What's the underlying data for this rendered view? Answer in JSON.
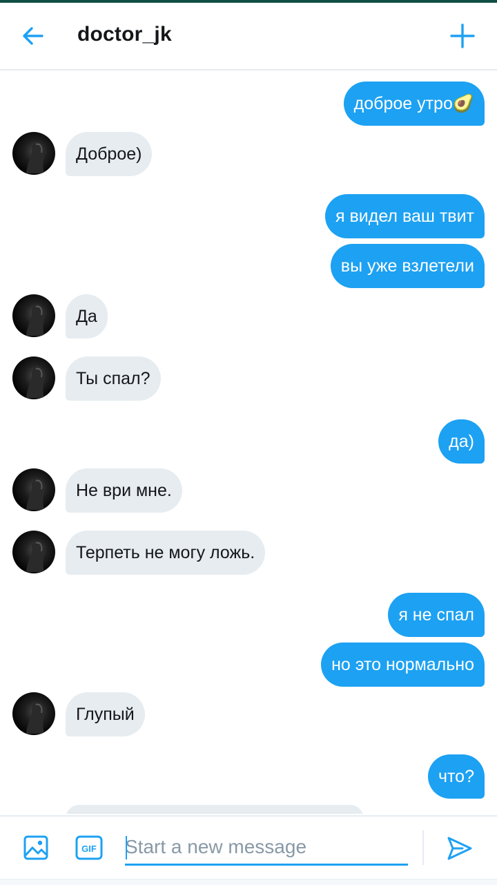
{
  "header": {
    "title": "doctor_jk",
    "back_icon": "arrow-left-icon",
    "new_icon": "plus-icon"
  },
  "messages": [
    {
      "dir": "out",
      "text": "доброе утро🥑"
    },
    {
      "dir": "in",
      "text": "Доброе)"
    },
    {
      "dir": "out",
      "text": "я видел ваш твит"
    },
    {
      "dir": "out",
      "text": "вы уже взлетели"
    },
    {
      "dir": "in",
      "text": "Да"
    },
    {
      "dir": "in",
      "text": "Ты спал?"
    },
    {
      "dir": "out",
      "text": "да)"
    },
    {
      "dir": "in",
      "text": "Не ври мне."
    },
    {
      "dir": "in",
      "text": "Терпеть не могу ложь."
    },
    {
      "dir": "out",
      "text": "я не спал"
    },
    {
      "dir": "out",
      "text": "но это нормально"
    },
    {
      "dir": "in",
      "text": "Глупый"
    },
    {
      "dir": "out",
      "text": "что?"
    }
  ],
  "composer": {
    "placeholder": "Start a new message",
    "value": "",
    "image_icon": "image-icon",
    "gif_icon": "gif-icon",
    "send_icon": "send-icon"
  },
  "colors": {
    "accent": "#1da1f2",
    "incoming_bubble": "#e6ecf0",
    "outgoing_bubble": "#1da1f2"
  }
}
